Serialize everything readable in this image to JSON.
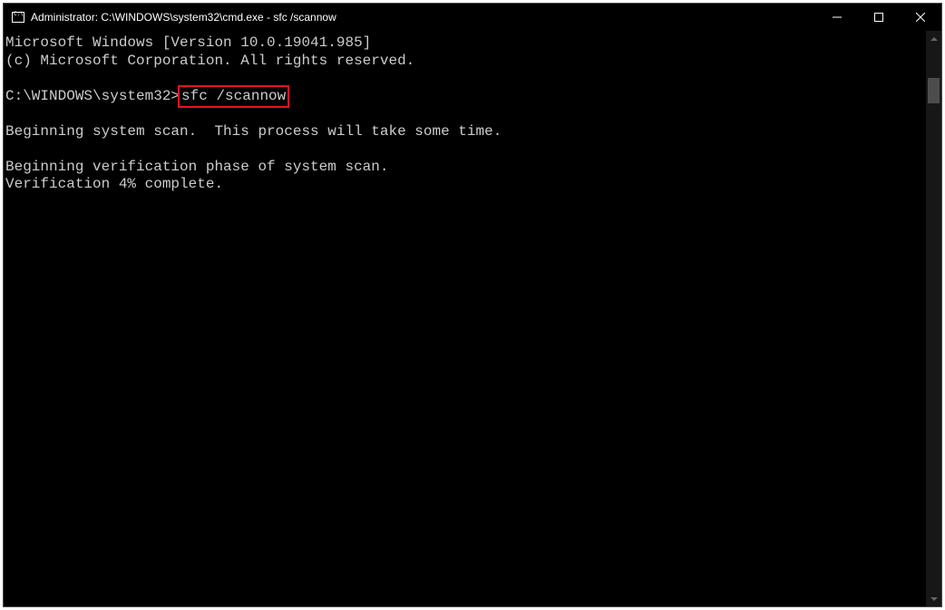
{
  "window": {
    "title": "Administrator: C:\\WINDOWS\\system32\\cmd.exe - sfc  /scannow"
  },
  "terminal": {
    "line1": "Microsoft Windows [Version 10.0.19041.985]",
    "line2": "(c) Microsoft Corporation. All rights reserved.",
    "prompt": "C:\\WINDOWS\\system32>",
    "command": "sfc /scannow",
    "line_scan": "Beginning system scan.  This process will take some time.",
    "line_verify": "Beginning verification phase of system scan.",
    "line_progress": "Verification 4% complete."
  }
}
